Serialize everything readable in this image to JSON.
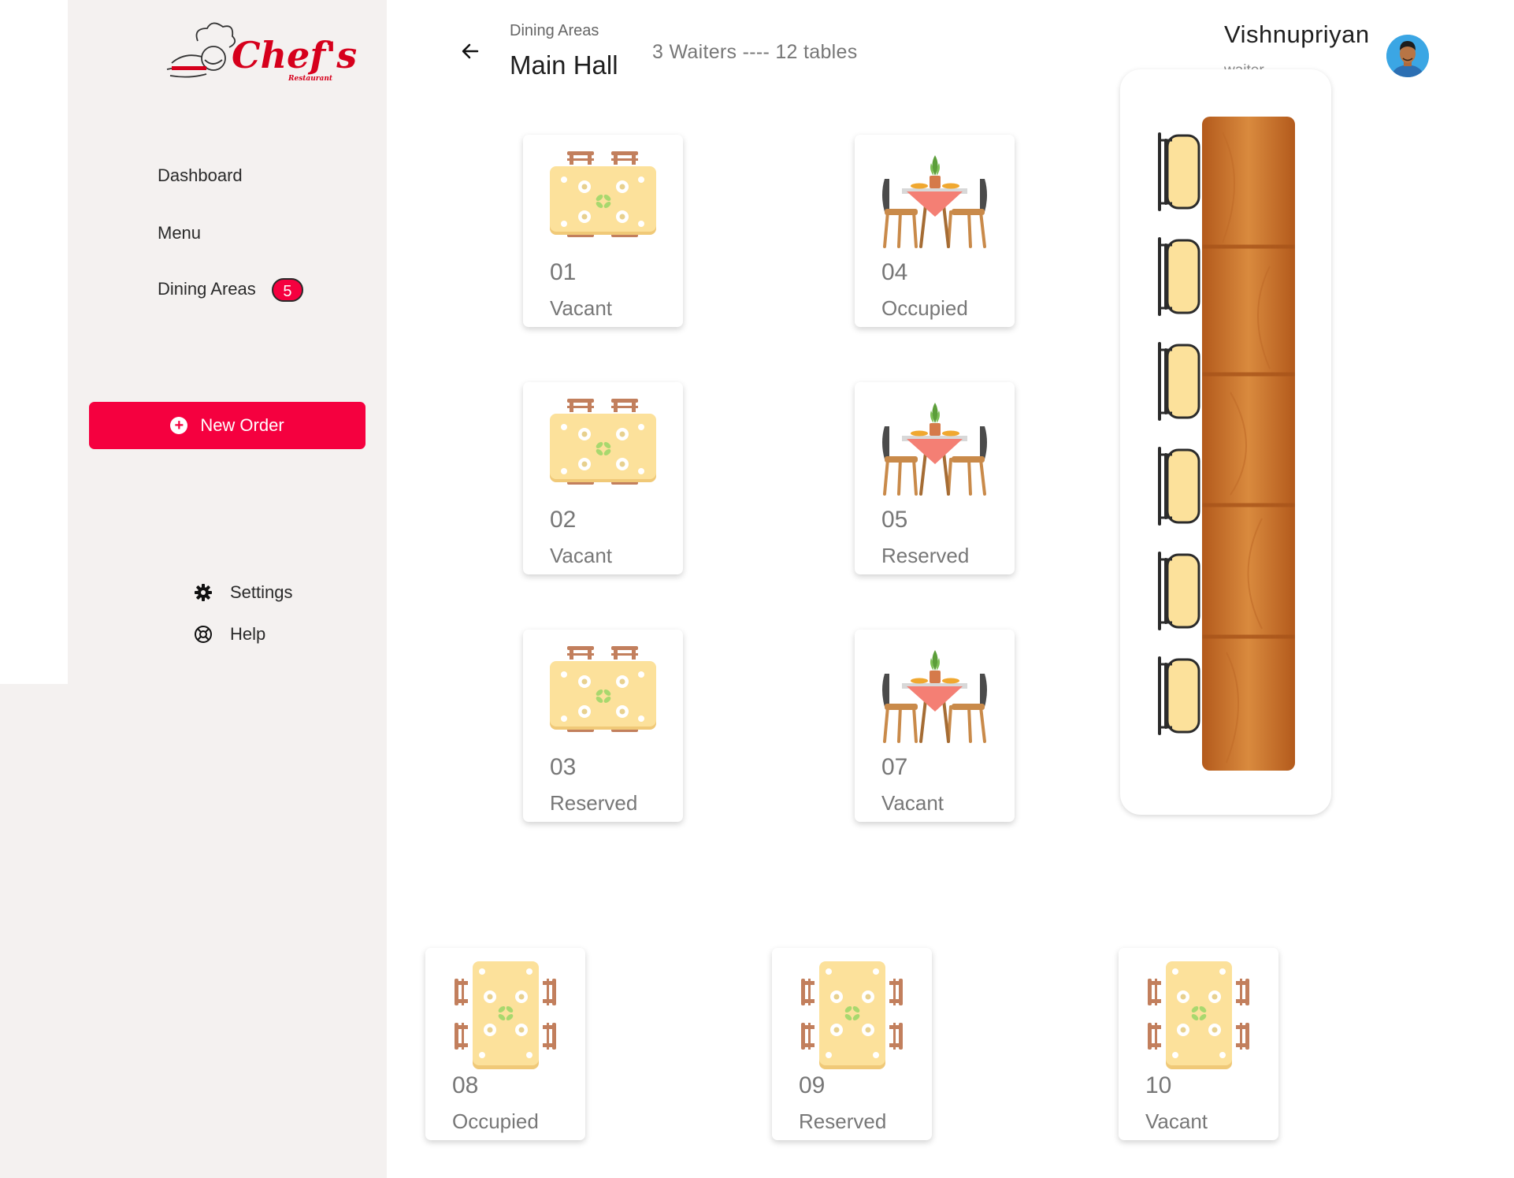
{
  "brand": {
    "logo_text": "Chef's",
    "logo_subtext": "Restaurant"
  },
  "nav": {
    "dashboard": "Dashboard",
    "menu": "Menu",
    "dining_areas": "Dining Areas",
    "dining_areas_badge": "5"
  },
  "new_order": {
    "label": "New Order"
  },
  "utility": {
    "settings": "Settings",
    "help": "Help"
  },
  "header": {
    "breadcrumb": "Dining Areas",
    "title": "Main Hall",
    "stats": "3 Waiters ---- 12 tables"
  },
  "user": {
    "name": "Vishnupriyan",
    "role": "waiter"
  },
  "tables": [
    {
      "number": "01",
      "status": "Vacant",
      "style": "square-table-icon"
    },
    {
      "number": "02",
      "status": "Vacant",
      "style": "square-table-icon"
    },
    {
      "number": "03",
      "status": "Reserved",
      "style": "square-table-icon"
    },
    {
      "number": "04",
      "status": "Occupied",
      "style": "bistro-table-icon"
    },
    {
      "number": "05",
      "status": "Reserved",
      "style": "bistro-table-icon"
    },
    {
      "number": "07",
      "status": "Vacant",
      "style": "bistro-table-icon"
    },
    {
      "number": "08",
      "status": "Occupied",
      "style": "vertical-table-icon"
    },
    {
      "number": "09",
      "status": "Reserved",
      "style": "vertical-table-icon"
    },
    {
      "number": "10",
      "status": "Vacant",
      "style": "vertical-table-icon"
    }
  ],
  "long_table": {
    "style": "long-wooden-table-icon",
    "chairs": 6
  },
  "colors": {
    "accent": "#f5003f",
    "sidebar_bg": "#f4f1f0",
    "wood": "#c96a26",
    "table_top": "#fce19b"
  }
}
